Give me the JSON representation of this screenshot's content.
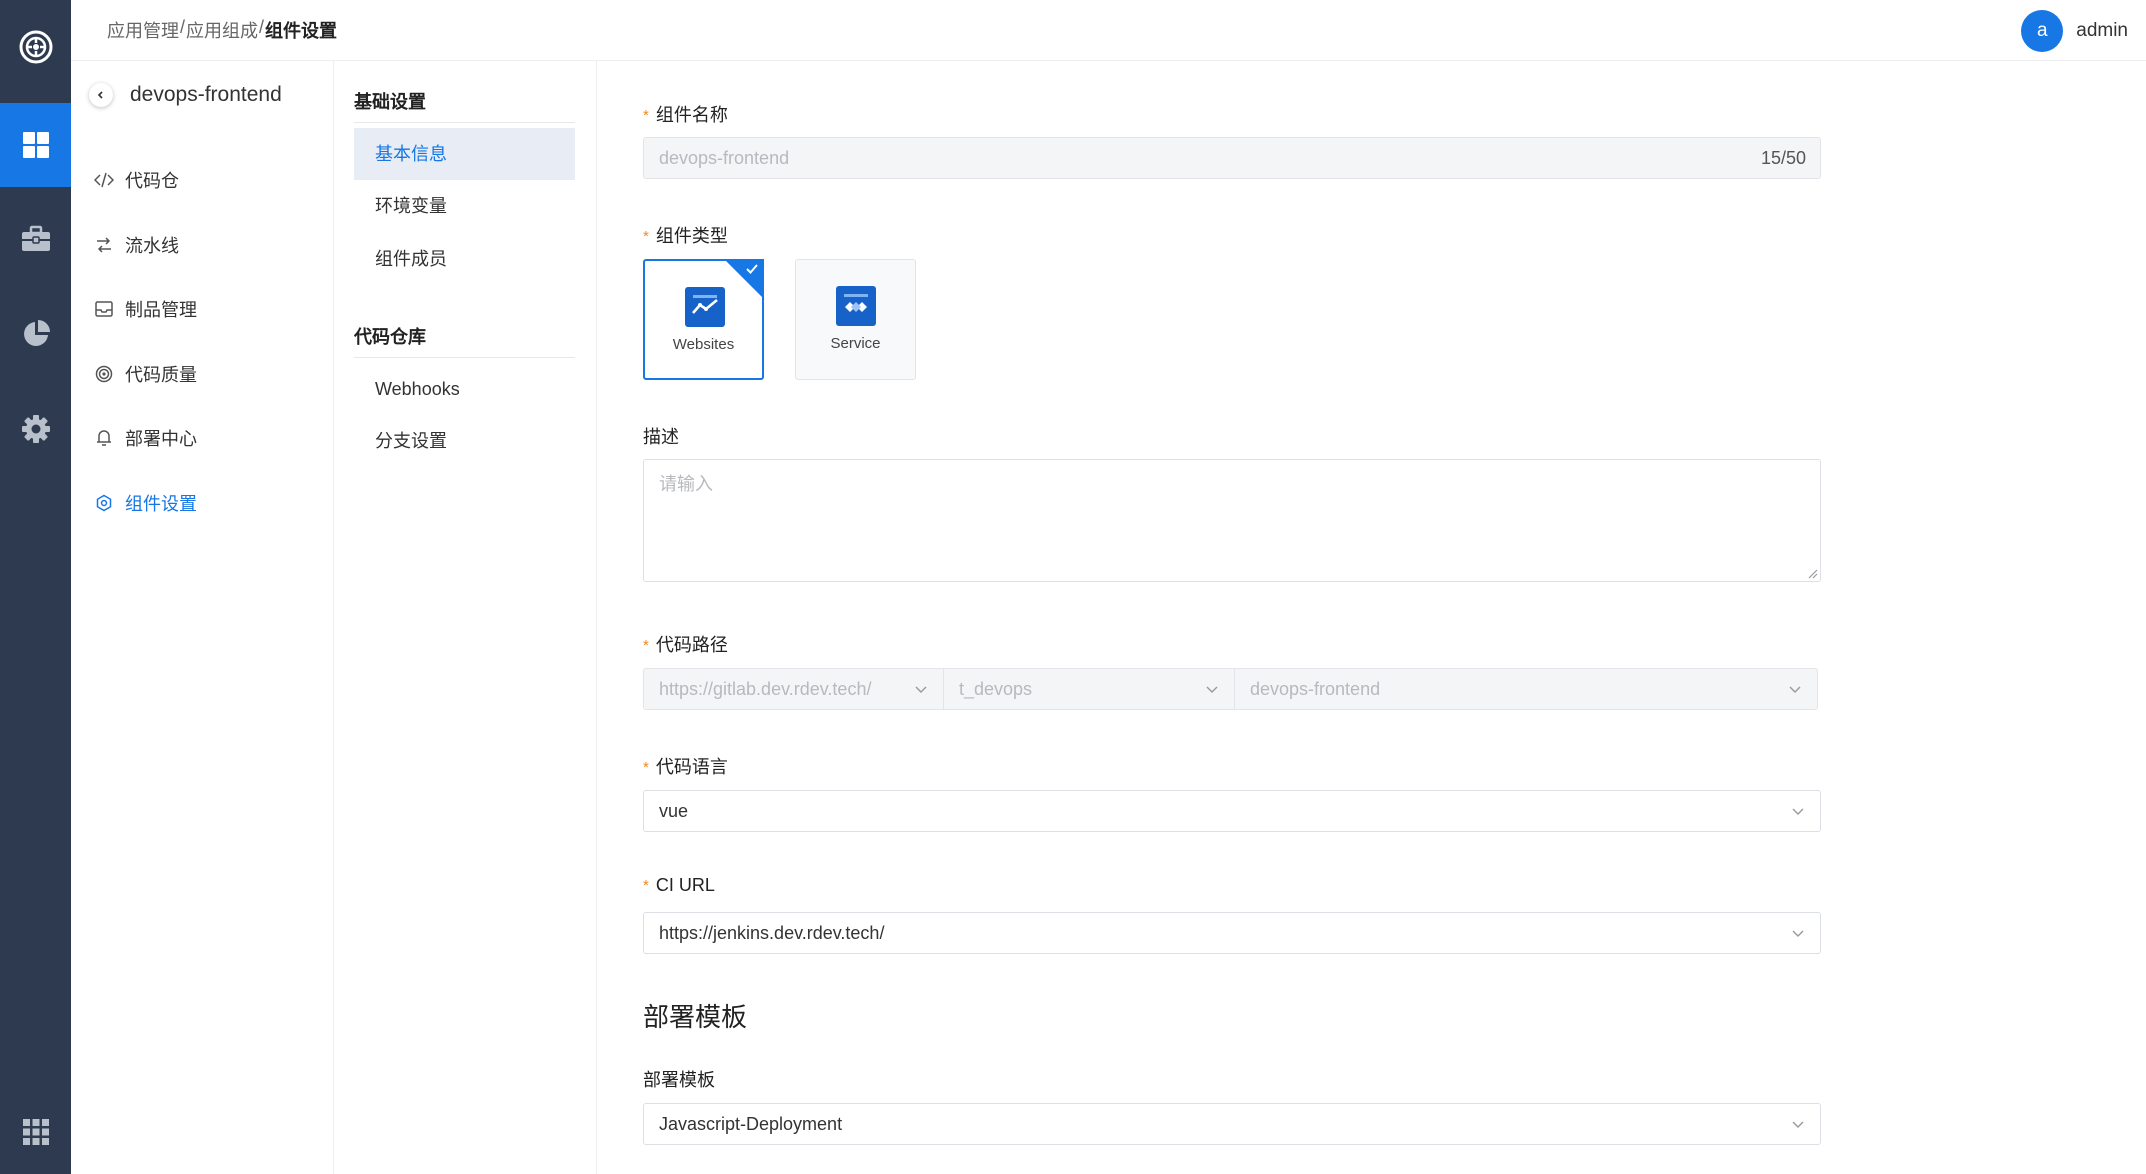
{
  "colors": {
    "rail_bg": "#2d3a4f",
    "accent": "#1677e5",
    "required": "#f5871f"
  },
  "rail": {
    "items": [
      {
        "icon": "logo-icon"
      },
      {
        "icon": "dashboard-grid-icon",
        "active": true
      },
      {
        "icon": "briefcase-icon"
      },
      {
        "icon": "pie-chart-icon"
      },
      {
        "icon": "gear-icon"
      },
      {
        "icon": "apps-grid-icon"
      }
    ]
  },
  "breadcrumb": {
    "items": [
      "应用管理",
      "应用组成"
    ],
    "sep": "/",
    "current": "组件设置"
  },
  "user": {
    "avatar_letter": "a",
    "name": "admin"
  },
  "app": {
    "name": "devops-frontend"
  },
  "nav2": {
    "items": [
      {
        "label": "代码仓",
        "icon": "code-icon"
      },
      {
        "label": "流水线",
        "icon": "pipeline-icon"
      },
      {
        "label": "制品管理",
        "icon": "inbox-icon"
      },
      {
        "label": "代码质量",
        "icon": "target-icon"
      },
      {
        "label": "部署中心",
        "icon": "bell-icon"
      },
      {
        "label": "组件设置",
        "icon": "settings-icon",
        "active": true
      }
    ]
  },
  "nav3": {
    "groups": [
      {
        "title": "基础设置",
        "items": [
          "基本信息",
          "环境变量",
          "组件成员"
        ],
        "active": "基本信息"
      },
      {
        "title": "代码仓库",
        "items": [
          "Webhooks",
          "分支设置"
        ]
      }
    ]
  },
  "form": {
    "name": {
      "label": "组件名称",
      "value": "devops-frontend",
      "count": "15/50"
    },
    "type": {
      "label": "组件类型",
      "options": [
        {
          "name": "Websites",
          "selected": true
        },
        {
          "name": "Service",
          "selected": false
        }
      ]
    },
    "description": {
      "label": "描述",
      "placeholder": "请输入"
    },
    "code_path": {
      "label": "代码路径",
      "parts": [
        "https://gitlab.dev.rdev.tech/",
        "t_devops",
        "devops-frontend"
      ]
    },
    "language": {
      "label": "代码语言",
      "value": "vue"
    },
    "ci_url": {
      "label": "CI URL",
      "value": "https://jenkins.dev.rdev.tech/"
    },
    "deploy_section_title": "部署模板",
    "deploy_template": {
      "label": "部署模板",
      "value": "Javascript-Deployment"
    }
  }
}
